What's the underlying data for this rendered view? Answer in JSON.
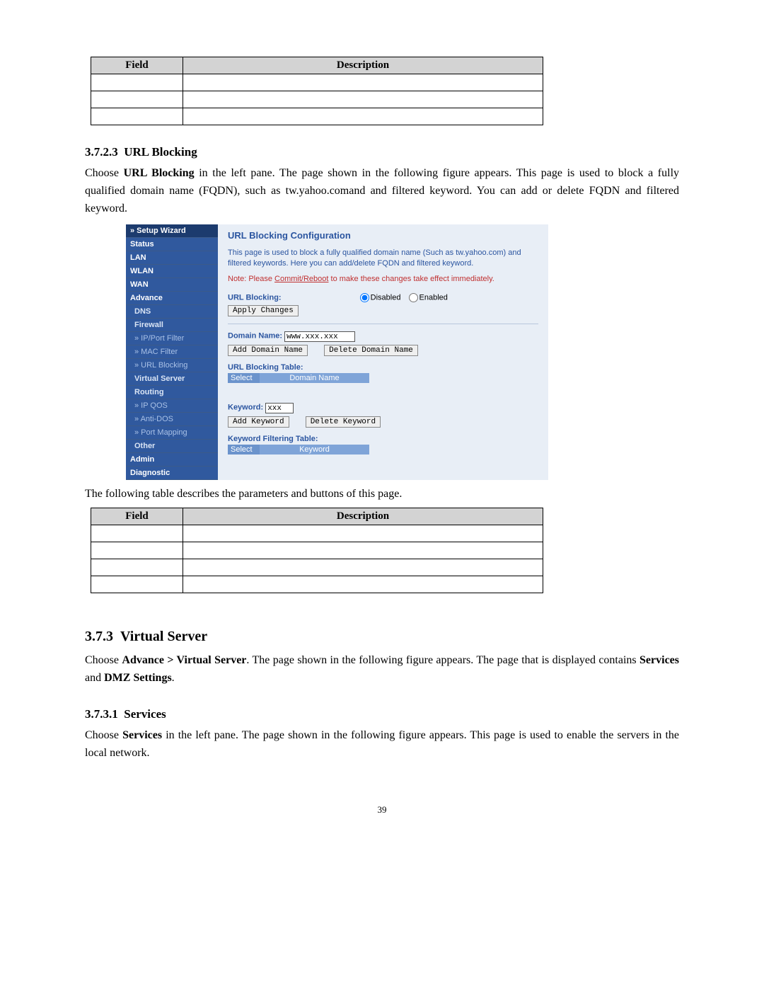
{
  "table1": {
    "headers": [
      "Field",
      "Description"
    ]
  },
  "section_url": {
    "num": "3.7.2.3",
    "title": "URL Blocking",
    "intro_a": "Choose ",
    "intro_b": "URL Blocking",
    "intro_c": " in the left pane. The page shown in the following figure appears. This page is used to block a fully qualified domain name (FQDN), such as tw.yahoo.comand and filtered keyword. You can add or delete FQDN and filtered keyword."
  },
  "router": {
    "nav": {
      "setup": "» Setup Wizard",
      "status": "Status",
      "lan": "LAN",
      "wlan": "WLAN",
      "wan": "WAN",
      "advance": "Advance",
      "dns": "DNS",
      "firewall": "Firewall",
      "ipport": "» IP/Port Filter",
      "mac": "» MAC Filter",
      "urlb": "» URL Blocking",
      "vserver": "Virtual Server",
      "routing": "Routing",
      "ipqos": "» IP QOS",
      "antidos": "» Anti-DOS",
      "portmap": "» Port Mapping",
      "other": "Other",
      "admin": "Admin",
      "diag": "Diagnostic"
    },
    "title": "URL Blocking Configuration",
    "desc": "This page is used to block a fully qualified domain name (Such as tw.yahoo.com) and filtered keywords. Here you can add/delete FQDN and filtered keyword.",
    "note_prefix": "Note: Please ",
    "note_link": "Commit/Reboot",
    "note_suffix": " to make these changes take effect immediately.",
    "url_blocking_label": "URL Blocking:",
    "disabled": "Disabled",
    "enabled": "Enabled",
    "apply": "Apply Changes",
    "domain_label": "Domain Name:",
    "domain_value": "www.xxx.xxx",
    "add_domain": "Add Domain Name",
    "del_domain": "Delete Domain Name",
    "url_table_title": "URL Blocking Table:",
    "tbl_select": "Select",
    "tbl_domain": "Domain Name",
    "keyword_label": "Keyword:",
    "keyword_value": "xxx",
    "add_keyword": "Add Keyword",
    "del_keyword": "Delete Keyword",
    "kw_table_title": "Keyword Filtering Table:",
    "tbl_keyword": "Keyword"
  },
  "table2_intro": "The following table describes the parameters and buttons of this page.",
  "table2": {
    "headers": [
      "Field",
      "Description"
    ]
  },
  "section_vs": {
    "num": "3.7.3",
    "title": "Virtual Server",
    "intro_a": "Choose ",
    "intro_b": "Advance > Virtual Server",
    "intro_c": ". The page shown in the following figure appears. The page that is displayed contains ",
    "intro_d": "Services",
    "intro_e": " and ",
    "intro_f": "DMZ Settings",
    "intro_g": "."
  },
  "section_svc": {
    "num": "3.7.3.1",
    "title": "Services",
    "intro_a": "Choose ",
    "intro_b": "Services",
    "intro_c": " in the left pane. The page shown in the following figure appears. This page is used to enable the servers in the local network."
  },
  "page_num": "39"
}
